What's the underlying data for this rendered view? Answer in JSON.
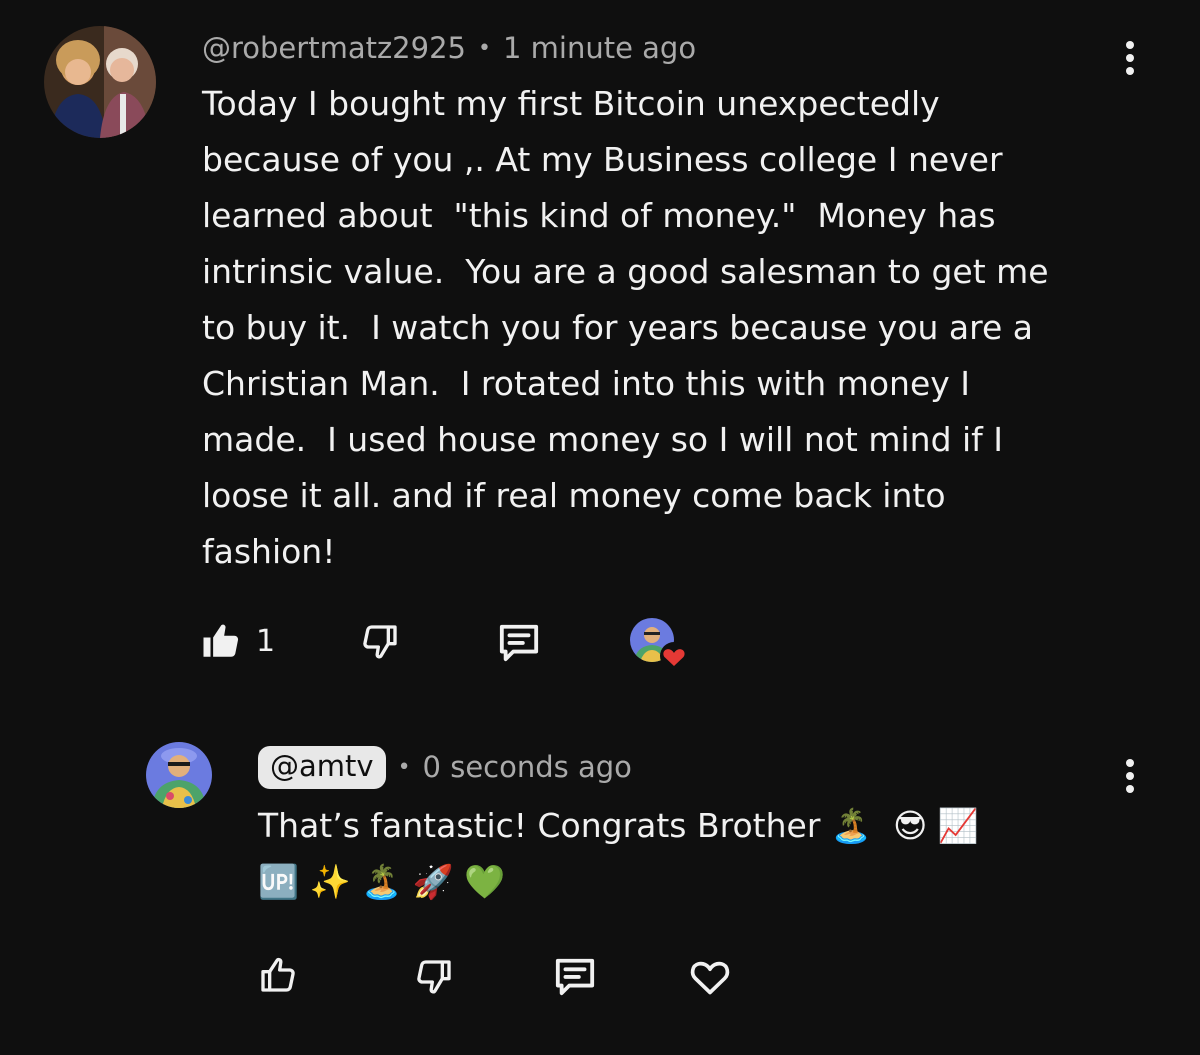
{
  "comment": {
    "author": "@robertmatz2925",
    "separator": "•",
    "time": "1 minute ago",
    "text": "Today I bought my first Bitcoin unexpectedly\nbecause of you ,. At my Business college I never\nlearned about  \"this kind of money.\"  Money has\nintrinsic value.  You are a good salesman to get me\nto buy it.  I watch you for years because you are a\nChristian Man.  I rotated into this with money I\nmade.  I used house money so I will not mind if I\nloose it all. and if real money come back into\nfashion!",
    "like_count": "1",
    "liked": true,
    "creator_hearted": true
  },
  "reply": {
    "author": "@amtv",
    "separator": "•",
    "time": "0 seconds ago",
    "text": "That’s fantastic! Congrats Brother 🏝️  😎 📈\n🆙 ✨ 🏝️ 🚀 💚"
  },
  "icons": {
    "like": "thumbs-up-icon",
    "dislike": "thumbs-down-icon",
    "reply": "comment-icon",
    "heart": "heart-icon",
    "more": "more-vert-icon"
  },
  "colors": {
    "background": "#0f0f0f",
    "text": "#f1f1f1",
    "secondary": "#aaaaaa",
    "heart_badge": "#e53935",
    "chip": "#e8e8e8"
  }
}
